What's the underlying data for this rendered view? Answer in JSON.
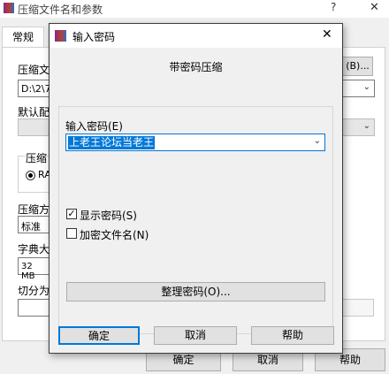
{
  "background_window": {
    "title": "压缩文件名和参数",
    "help_symbol": "?",
    "close_symbol": "✕",
    "tab_general": "常规",
    "archive_name_label": "压缩文",
    "browse_button": "(B)...",
    "archive_path_value": "D:\\2\\7",
    "default_config_label": "默认配",
    "format_group_label": "压缩",
    "radio_rar_label": "RA",
    "method_label": "压缩方",
    "method_value": "标准",
    "dict_label": "字典大",
    "dict_value": "32 MB",
    "split_label": "切分为",
    "ok_button": "确定",
    "cancel_button": "取消",
    "help_button": "帮助"
  },
  "dialog": {
    "title": "输入密码",
    "close_symbol": "✕",
    "heading": "带密码压缩",
    "password_label": "输入密码(E)",
    "password_value": "上老王论坛当老王",
    "show_password_label": "显示密码(S)",
    "show_password_checked": true,
    "encrypt_filenames_label": "加密文件名(N)",
    "encrypt_filenames_checked": false,
    "organize_button": "整理密码(O)...",
    "ok_button": "确定",
    "cancel_button": "取消",
    "help_button": "帮助"
  },
  "colors": {
    "selection": "#0078d7",
    "background": "#f0f0f0",
    "button_face": "#e1e1e1"
  }
}
